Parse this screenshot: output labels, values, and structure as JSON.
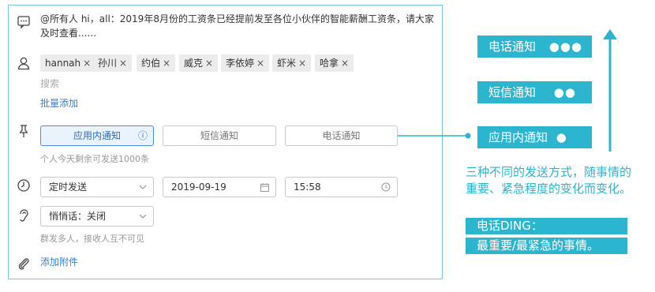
{
  "message": "@所有人 hi，all：2019年8月份的工资条已经提前发至各位小伙伴的智能薪酬工资条，请大家及时查看......",
  "recipients": {
    "tags": [
      "hannah",
      "孙川",
      "约伯",
      "威克",
      "李依婷",
      "虾米",
      "哈拿"
    ],
    "remove_glyph": "×",
    "search_placeholder": "搜索",
    "batch_add": "批量添加"
  },
  "notify": {
    "options": [
      "应用内通知",
      "短信通知",
      "电话通知"
    ],
    "selected": "应用内通知",
    "info_glyph": "ⓘ",
    "quota_hint": "个人今天剩余可发送1000条"
  },
  "schedule": {
    "mode": "定时发送",
    "date": "2019-09-19",
    "time": "15:58"
  },
  "whisper": {
    "value": "悄悄话：关闭",
    "hint": "群发多人，接收人互不可见"
  },
  "attachment": {
    "label": "添加附件"
  },
  "annotation": {
    "levels": [
      {
        "label": "电话通知",
        "dots": "●●●"
      },
      {
        "label": "短信通知",
        "dots": "●●"
      },
      {
        "label": "应用内通知",
        "dots": "●"
      }
    ],
    "note": "三种不同的发送方式，随事情的重要、紧急程度的变化而变化。",
    "ding_title": "电话DING：",
    "ding_desc": "最重要/最紧急的事情。"
  },
  "colors": {
    "accent": "#2bb5cf",
    "link": "#3a7fd0",
    "border": "#79c6d8"
  }
}
